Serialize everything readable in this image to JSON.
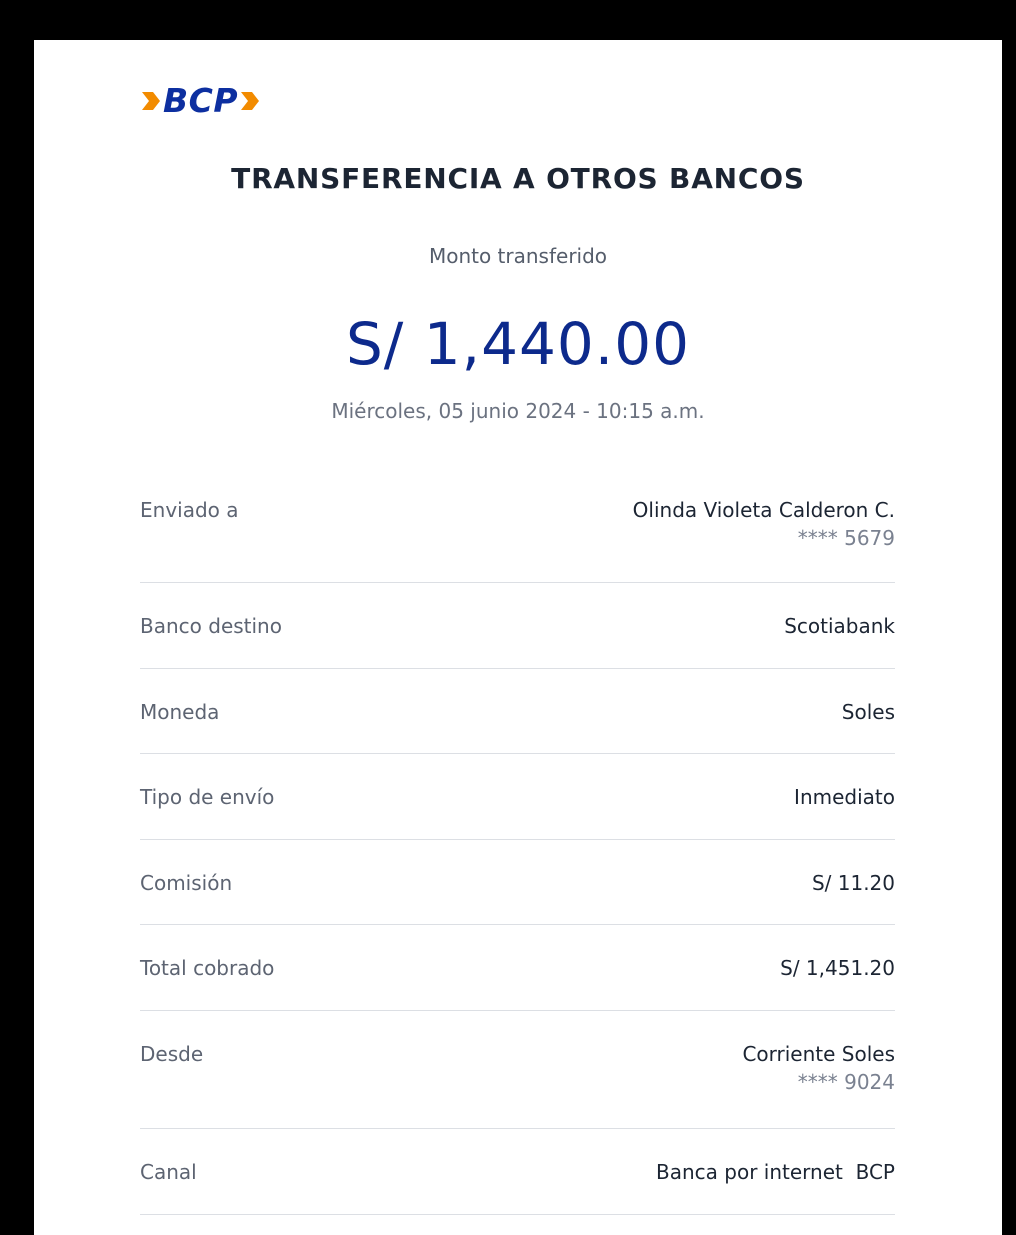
{
  "brand": {
    "logo_text": "BCP",
    "primary_color": "#0d2a8c",
    "accent_color": "#f28b00"
  },
  "receipt": {
    "title": "TRANSFERENCIA A OTROS BANCOS",
    "amount_label": "Monto transferido",
    "amount": "S/ 1,440.00",
    "datetime": "Miércoles, 05 junio 2024 - 10:15 a.m."
  },
  "details": [
    {
      "label": "Enviado a",
      "value": "Olinda Violeta Calderon C.",
      "sub": "**** 5679"
    },
    {
      "label": "Banco destino",
      "value": "Scotiabank"
    },
    {
      "label": "Moneda",
      "value": "Soles"
    },
    {
      "label": "Tipo de envío",
      "value": "Inmediato"
    },
    {
      "label": "Comisión",
      "value": "S/ 11.20"
    },
    {
      "label": "Total cobrado",
      "value": "S/ 1,451.20"
    },
    {
      "label": "Desde",
      "value": "Corriente Soles",
      "sub": "**** 9024"
    },
    {
      "label": "Canal",
      "value": "Banca por internet  BCP"
    }
  ]
}
